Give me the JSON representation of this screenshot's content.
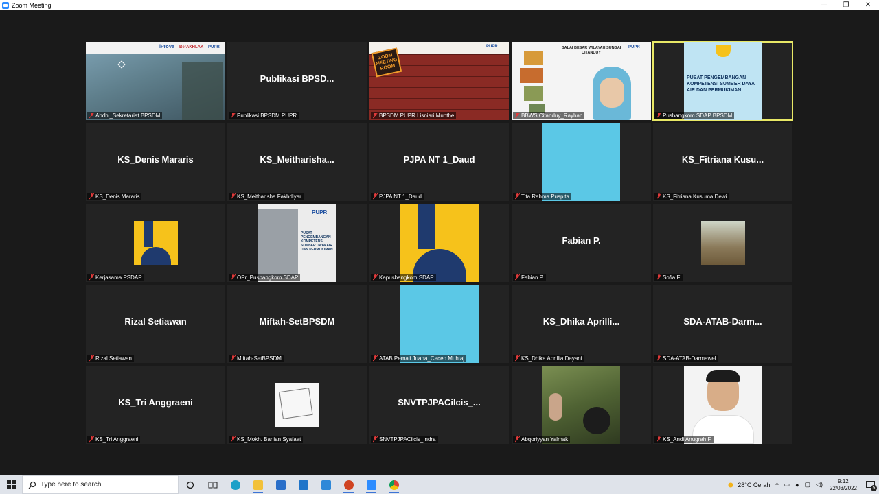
{
  "window": {
    "title": "Zoom Meeting",
    "controls": [
      "—",
      "❐",
      "✕"
    ]
  },
  "tiles": [
    {
      "label": "Abdhi_Sekretariat BPSDM",
      "center": ""
    },
    {
      "label": "Publikasi BPSDM PUPR",
      "center": "Publikasi  BPSD..."
    },
    {
      "label": "BPSDM PUPR Lisniari Munthe",
      "center": ""
    },
    {
      "label": "BBWS Citanduy_Rayhan",
      "center": ""
    },
    {
      "label": "Pusbangkom SDAP BPSDM",
      "center": ""
    },
    {
      "label": "KS_Denis Mararis",
      "center": "KS_Denis Mararis"
    },
    {
      "label": "KS_Meitharisha Fakhdiyar",
      "center": "KS_Meitharisha..."
    },
    {
      "label": "PJPA NT 1_Daud",
      "center": "PJPA NT 1_Daud"
    },
    {
      "label": "Tita Rahma Puspita",
      "center": ""
    },
    {
      "label": "KS_Fitriana Kusuma Dewi",
      "center": "KS_Fitriana  Kusu..."
    },
    {
      "label": "Kerjasama PSDAP",
      "center": ""
    },
    {
      "label": "OPr_Pusbangkom SDAP",
      "center": ""
    },
    {
      "label": "Kapusbangkom SDAP",
      "center": ""
    },
    {
      "label": "Fabian P.",
      "center": "Fabian P."
    },
    {
      "label": "Sofia F.",
      "center": ""
    },
    {
      "label": "Rizal Setiawan",
      "center": "Rizal Setiawan"
    },
    {
      "label": "Miftah-SetBPSDM",
      "center": "Miftah-SetBPSDM"
    },
    {
      "label": "ATAB Pemali Juana_Cecep Muhtaj",
      "center": ""
    },
    {
      "label": "KS_Dhika Aprillia Dayani",
      "center": "KS_Dhika  Aprilli..."
    },
    {
      "label": "SDA-ATAB-Darmawel",
      "center": "SDA-ATAB-Darm..."
    },
    {
      "label": "KS_Tri Anggraeni",
      "center": "KS_Tri Anggraeni"
    },
    {
      "label": "KS_Mokh. Barlian Syafaat",
      "center": ""
    },
    {
      "label": "SNVTPJPACilcis_Indra",
      "center": "SNVTPJPACilcis_..."
    },
    {
      "label": "Abqoriyyan Yalmak",
      "center": ""
    },
    {
      "label": "KS_Andi Anugrah F.",
      "center": ""
    }
  ],
  "slides": {
    "pusbangkom_text": "PUSAT PENGEMBANGAN KOMPETENSI SUMBER DAYA AIR DAN PERMUKIMAN",
    "zoom_room": "ZOOM MEETING ROOM",
    "bbws_header": "BALAI BESAR WILAYAH SUNGAI CITANDUY",
    "pupr": "PUPR",
    "iproVe": "iProVe",
    "berakhlak": "BerAKHLAK",
    "opr_text": "PUSAT PENGEMBANGAN KOMPETENSI SUMBER DAYA AIR DAN PERMUKIMAN"
  },
  "taskbar": {
    "search_placeholder": "Type here to search",
    "weather": "28°C  Cerah",
    "time": "9:12",
    "date": "22/03/2022",
    "notifications": "5"
  },
  "colors": {
    "active_border": "#e8e866",
    "tile_bg": "#232323",
    "mute_red": "#e03a3a"
  }
}
